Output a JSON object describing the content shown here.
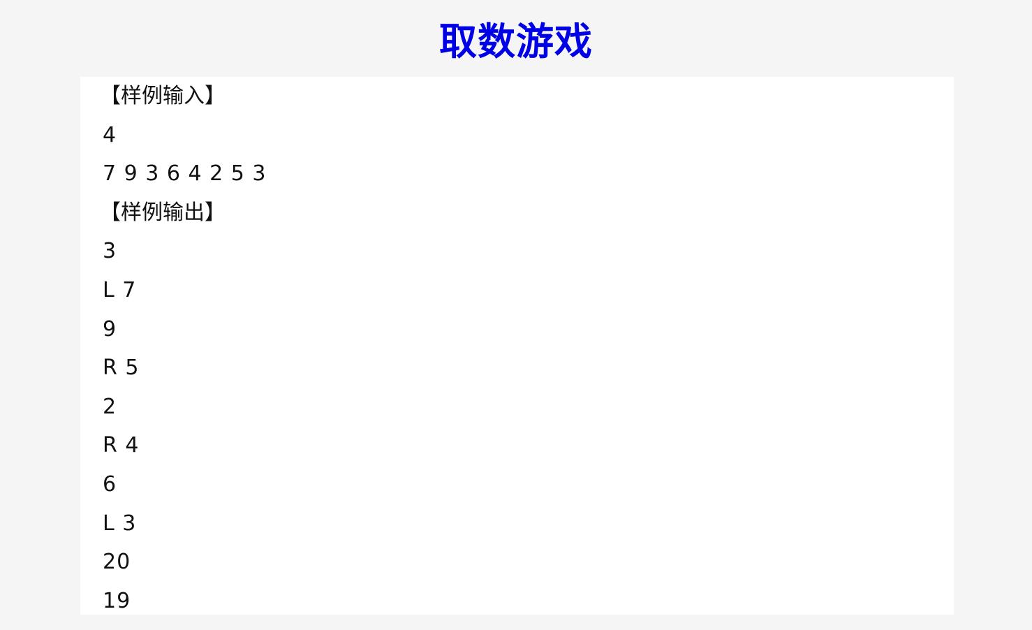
{
  "page": {
    "title": "取数游戏",
    "title_color": "#0000e6",
    "background_color": "#f5f5f5",
    "panel_color": "#ffffff"
  },
  "content": {
    "lines": [
      {
        "text": "【样例输入】",
        "kind": "heading"
      },
      {
        "text": "4",
        "kind": "text"
      },
      {
        "text": "7 9 3 6 4 2 5 3",
        "kind": "text"
      },
      {
        "text": "【样例输出】",
        "kind": "heading"
      },
      {
        "text": "3",
        "kind": "text"
      },
      {
        "text": "L 7",
        "kind": "text"
      },
      {
        "text": "9",
        "kind": "text"
      },
      {
        "text": "R 5",
        "kind": "text"
      },
      {
        "text": "2",
        "kind": "text"
      },
      {
        "text": "R 4",
        "kind": "text"
      },
      {
        "text": "6",
        "kind": "text"
      },
      {
        "text": "L 3",
        "kind": "text"
      },
      {
        "text": "20",
        "kind": "text"
      },
      {
        "text": "19",
        "kind": "text"
      }
    ]
  }
}
